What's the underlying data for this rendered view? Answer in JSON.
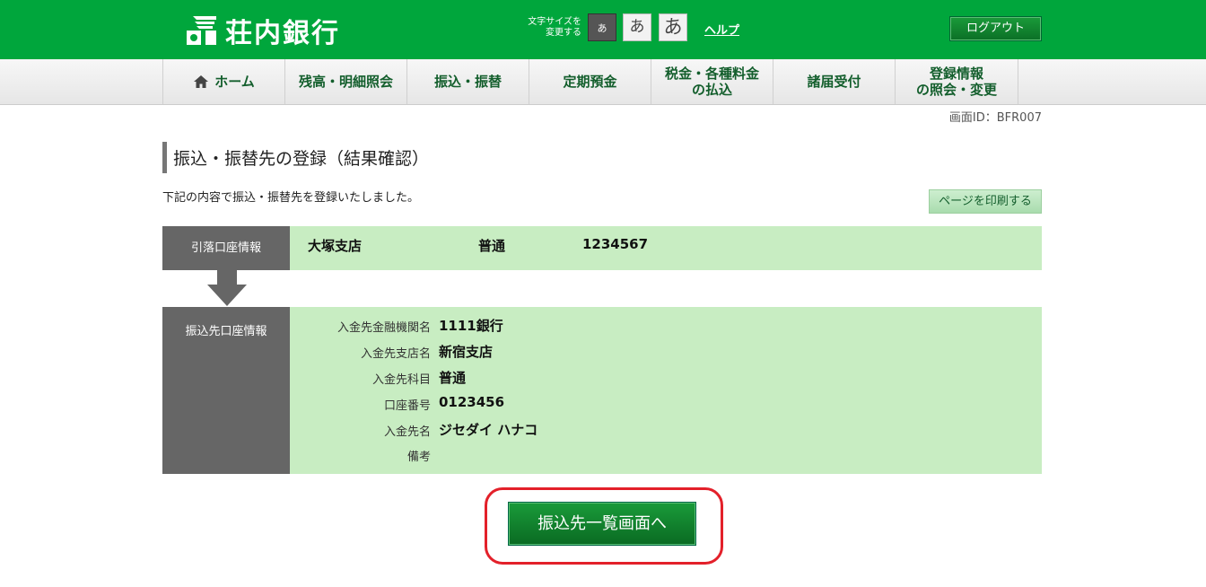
{
  "header": {
    "bank_name": "荘内銀行",
    "font_size_label_line1": "文字サイズを",
    "font_size_label_line2": "変更する",
    "font_sizes": [
      "あ",
      "あ",
      "あ"
    ],
    "help_label": "ヘルプ",
    "logout_label": "ログアウト"
  },
  "nav": {
    "items": [
      {
        "label": "ホーム"
      },
      {
        "label": "残高・明細照会"
      },
      {
        "label": "振込・振替"
      },
      {
        "label": "定期預金"
      },
      {
        "label_line1": "税金・各種料金",
        "label_line2": "の払込"
      },
      {
        "label": "諸届受付"
      },
      {
        "label_line1": "登録情報",
        "label_line2": "の照会・変更"
      }
    ]
  },
  "screen_id": "画面ID：BFR007",
  "page": {
    "title": "振込・振替先の登録（結果確認）",
    "description": "下記の内容で振込・振替先を登録いたしました。",
    "print_label": "ページを印刷する"
  },
  "from_account": {
    "label": "引落口座情報",
    "branch": "大塚支店",
    "type": "普通",
    "number": "1234567"
  },
  "to_account": {
    "label": "振込先口座情報",
    "rows": [
      {
        "key": "入金先金融機関名",
        "value": "1111銀行"
      },
      {
        "key": "入金先支店名",
        "value": "新宿支店"
      },
      {
        "key": "入金先科目",
        "value": "普通"
      },
      {
        "key": "口座番号",
        "value": "0123456"
      },
      {
        "key": "入金先名",
        "value": "ジセダイ ハナコ"
      },
      {
        "key": "備考",
        "value": ""
      }
    ]
  },
  "actions": {
    "list_button_label": "振込先一覧画面へ"
  },
  "colors": {
    "brand_green": "#00a63c",
    "panel_green": "#c8edc2",
    "label_gray": "#666666",
    "highlight_red": "#e3202a"
  }
}
